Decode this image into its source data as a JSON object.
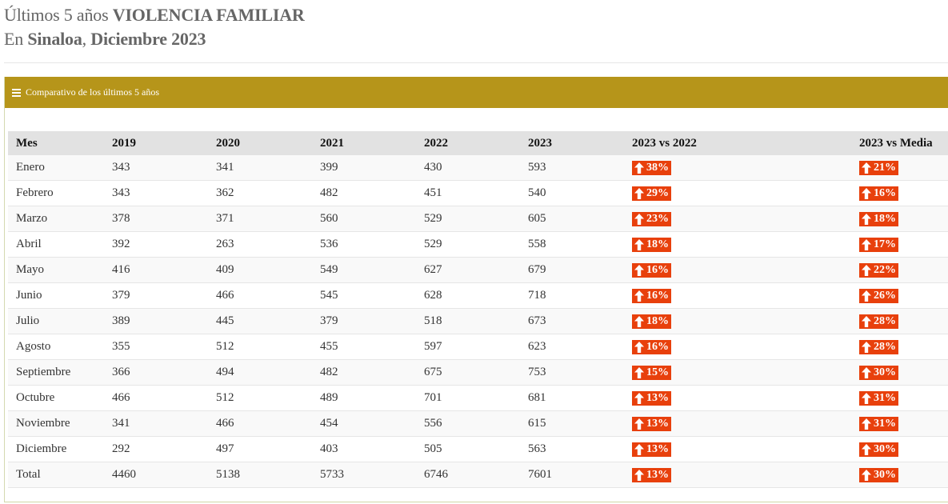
{
  "heading": {
    "line1_prefix": "Últimos 5 años",
    "line1_bold": "VIOLENCIA FAMILIAR",
    "line2_prefix": "En",
    "line2_state": "Sinaloa",
    "line2_sep": ",",
    "line2_period": "Diciembre 2023"
  },
  "panel": {
    "title": "Comparativo de los últimos 5 años",
    "icon": "menu-bars-icon",
    "header_color": "#b6951a"
  },
  "table": {
    "columns": [
      "Mes",
      "2019",
      "2020",
      "2021",
      "2022",
      "2023",
      "2023 vs 2022",
      "2023 vs Media"
    ],
    "badge_color": "#e8400c",
    "badge_icon": "arrow-up-icon",
    "rows": [
      {
        "mes": "Enero",
        "y2019": "343",
        "y2020": "341",
        "y2021": "399",
        "y2022": "430",
        "y2023": "593",
        "vs2022": "38%",
        "vsmedia": "21%"
      },
      {
        "mes": "Febrero",
        "y2019": "343",
        "y2020": "362",
        "y2021": "482",
        "y2022": "451",
        "y2023": "540",
        "vs2022": "29%",
        "vsmedia": "16%"
      },
      {
        "mes": "Marzo",
        "y2019": "378",
        "y2020": "371",
        "y2021": "560",
        "y2022": "529",
        "y2023": "605",
        "vs2022": "23%",
        "vsmedia": "18%"
      },
      {
        "mes": "Abril",
        "y2019": "392",
        "y2020": "263",
        "y2021": "536",
        "y2022": "529",
        "y2023": "558",
        "vs2022": "18%",
        "vsmedia": "17%"
      },
      {
        "mes": "Mayo",
        "y2019": "416",
        "y2020": "409",
        "y2021": "549",
        "y2022": "627",
        "y2023": "679",
        "vs2022": "16%",
        "vsmedia": "22%"
      },
      {
        "mes": "Junio",
        "y2019": "379",
        "y2020": "466",
        "y2021": "545",
        "y2022": "628",
        "y2023": "718",
        "vs2022": "16%",
        "vsmedia": "26%"
      },
      {
        "mes": "Julio",
        "y2019": "389",
        "y2020": "445",
        "y2021": "379",
        "y2022": "518",
        "y2023": "673",
        "vs2022": "18%",
        "vsmedia": "28%"
      },
      {
        "mes": "Agosto",
        "y2019": "355",
        "y2020": "512",
        "y2021": "455",
        "y2022": "597",
        "y2023": "623",
        "vs2022": "16%",
        "vsmedia": "28%"
      },
      {
        "mes": "Septiembre",
        "y2019": "366",
        "y2020": "494",
        "y2021": "482",
        "y2022": "675",
        "y2023": "753",
        "vs2022": "15%",
        "vsmedia": "30%"
      },
      {
        "mes": "Octubre",
        "y2019": "466",
        "y2020": "512",
        "y2021": "489",
        "y2022": "701",
        "y2023": "681",
        "vs2022": "13%",
        "vsmedia": "31%"
      },
      {
        "mes": "Noviembre",
        "y2019": "341",
        "y2020": "466",
        "y2021": "454",
        "y2022": "556",
        "y2023": "615",
        "vs2022": "13%",
        "vsmedia": "31%"
      },
      {
        "mes": "Diciembre",
        "y2019": "292",
        "y2020": "497",
        "y2021": "403",
        "y2022": "505",
        "y2023": "563",
        "vs2022": "13%",
        "vsmedia": "30%"
      },
      {
        "mes": "Total",
        "y2019": "4460",
        "y2020": "5138",
        "y2021": "5733",
        "y2022": "6746",
        "y2023": "7601",
        "vs2022": "13%",
        "vsmedia": "30%"
      }
    ]
  }
}
